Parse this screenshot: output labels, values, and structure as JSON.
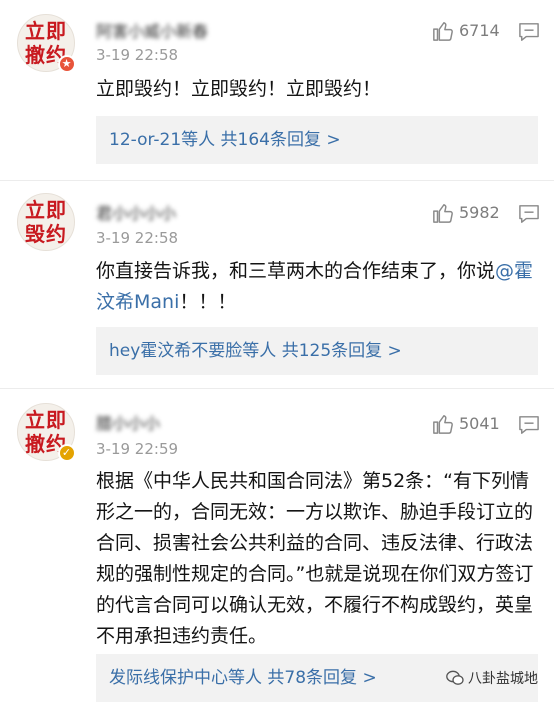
{
  "comments": [
    {
      "avatar_line1": "立即",
      "avatar_line2": "撤约",
      "username": "阿害小威小新春",
      "time": "3-19 22:58",
      "likes": "6714",
      "text": "立即毁约！立即毁约！立即毁约！",
      "reply_summary": "12-or-21等人  共164条回复 >"
    },
    {
      "avatar_line1": "立即",
      "avatar_line2": "毁约",
      "username": "君小小小小",
      "time": "3-19 22:58",
      "likes": "5982",
      "text": "你直接告诉我，和三草两木的合作结束了，你说",
      "mention": "@霍汶希Mani",
      "text_suffix": "！！！",
      "reply_summary": "hey霍汶希不要脸等人  共125条回复 >"
    },
    {
      "avatar_line1": "立即",
      "avatar_line2": "撤约",
      "username": "腊小小小",
      "time": "3-19 22:59",
      "likes": "5041",
      "text": "根据《中华人民共和国合同法》第52条：“有下列情形之一的，合同无效：一方以欺诈、胁迫手段订立的合同、损害社会公共利益的合同、违反法律、行政法规的强制性规定的合同。”也就是说现在你们双方签订的代言合同可以确认无效，不履行不构成毁约，英皇不用承担违约责任。",
      "reply_summary": "发际线保护中心等人  共78条回复 >"
    }
  ],
  "watermark": "八卦盐城地",
  "colors": {
    "link": "#3a6fa8",
    "avatar_text": "#c8191f",
    "meta": "#9a9a9a"
  }
}
